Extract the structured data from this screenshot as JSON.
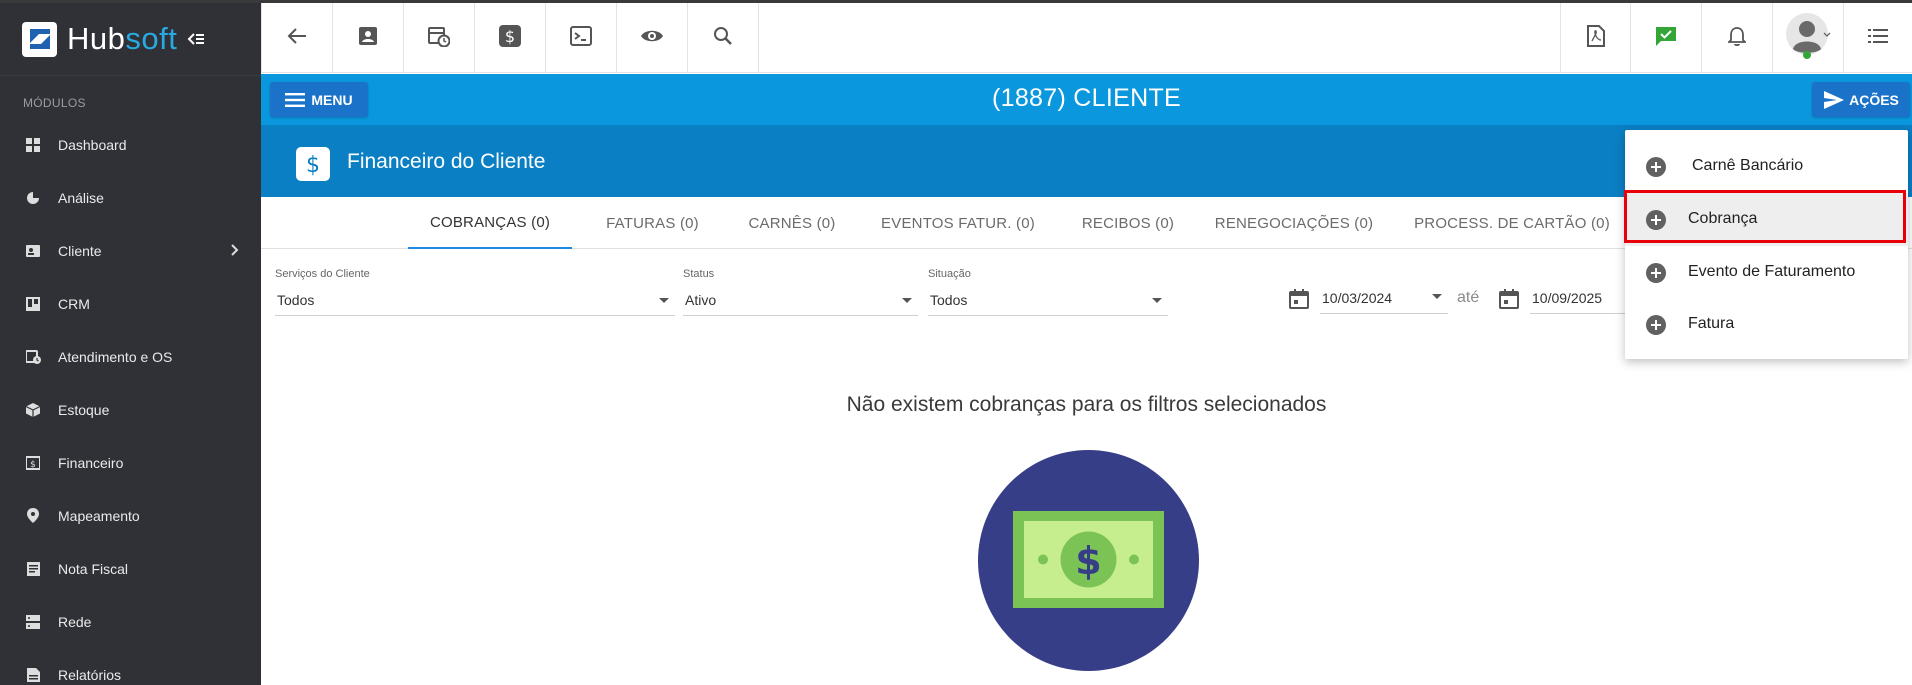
{
  "brand": {
    "logo_icon": "hubsoft-logo-icon",
    "name_part1": "Hub",
    "name_part2": "soft",
    "colors": {
      "hub": "#ffffff",
      "soft": "#29a9e1"
    }
  },
  "sidebar": {
    "section_label": "MÓDULOS",
    "items": [
      {
        "label": "Dashboard",
        "icon": "grid-icon"
      },
      {
        "label": "Análise",
        "icon": "pie-chart-icon"
      },
      {
        "label": "Cliente",
        "icon": "contact-card-icon",
        "has_submenu": true
      },
      {
        "label": "CRM",
        "icon": "crm-board-icon"
      },
      {
        "label": "Atendimento e OS",
        "icon": "calendar-clock-icon"
      },
      {
        "label": "Estoque",
        "icon": "box-icon"
      },
      {
        "label": "Financeiro",
        "icon": "money-icon"
      },
      {
        "label": "Mapeamento",
        "icon": "map-pin-icon"
      },
      {
        "label": "Nota Fiscal",
        "icon": "document-icon"
      },
      {
        "label": "Rede",
        "icon": "server-icon"
      },
      {
        "label": "Relatórios",
        "icon": "report-icon"
      }
    ]
  },
  "toolbar": {
    "left_icons": [
      "back-arrow-icon",
      "contact-card-icon",
      "calendar-clock-icon",
      "dollar-icon",
      "terminal-icon",
      "eye-icon",
      "search-icon"
    ],
    "right_icons": [
      "pdf-icon",
      "chat-check-icon",
      "bell-icon",
      "user-avatar-icon",
      "list-icon"
    ]
  },
  "header": {
    "menu_label": "MENU",
    "title": "(1887) CLIENTE",
    "actions_label": "AÇÕES",
    "bar_color": "#0a97dd"
  },
  "section": {
    "title": "Financeiro do Cliente",
    "icon": "dollar-icon",
    "color": "#0a7fc4"
  },
  "tabs": [
    {
      "label": "COBRANÇAS (0)",
      "active": true
    },
    {
      "label": "FATURAS (0)"
    },
    {
      "label": "CARNÊS (0)"
    },
    {
      "label": "EVENTOS FATUR. (0)"
    },
    {
      "label": "RECIBOS (0)"
    },
    {
      "label": "RENEGOCIAÇÕES (0)"
    },
    {
      "label": "PROCESS. DE CARTÃO (0)"
    }
  ],
  "filters": {
    "servicos": {
      "label": "Serviços do Cliente",
      "value": "Todos"
    },
    "status": {
      "label": "Status",
      "value": "Ativo"
    },
    "situacao": {
      "label": "Situação",
      "value": "Todos"
    },
    "date_from": "10/03/2024",
    "date_sep": "até",
    "date_to": "10/09/2025"
  },
  "empty_state": {
    "message": "Não existem cobranças para os filtros selecionados",
    "illustration": "money-bill-icon"
  },
  "actions_menu": {
    "items": [
      {
        "label": "Carnê Bancário"
      },
      {
        "label": "Cobrança",
        "highlighted": true
      },
      {
        "label": "Evento de Faturamento"
      },
      {
        "label": "Fatura"
      }
    ]
  }
}
